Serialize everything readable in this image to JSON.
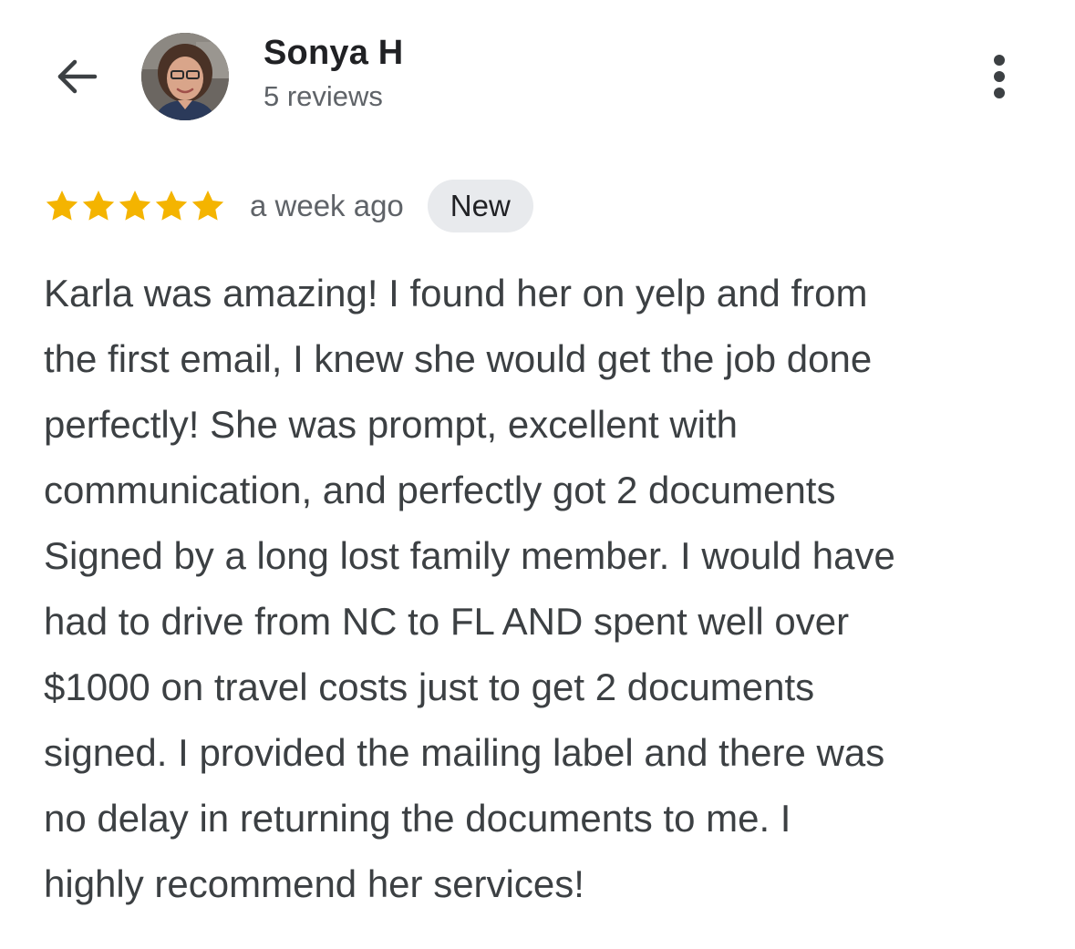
{
  "header": {
    "back_icon": "arrow-left-icon",
    "more_icon": "more-vert-icon",
    "reviewer_name": "Sonya H",
    "review_count": "5 reviews"
  },
  "review": {
    "rating": 5,
    "rating_max": 5,
    "star_color": "#f4b400",
    "time_ago": "a week ago",
    "badge": "New",
    "text_lines": [
      "Karla was amazing! I found her on yelp and from",
      "the first email, I knew she would get the job done",
      "perfectly! She was prompt, excellent with",
      "communication, and perfectly got 2 documents",
      "Signed by a long lost family member. I would have",
      "had to drive from NC to FL AND spent well over",
      "$1000 on travel costs just to get 2 documents",
      "signed. I provided the mailing label and there was",
      "no delay in returning the documents to me. I",
      "highly recommend her services!"
    ]
  }
}
